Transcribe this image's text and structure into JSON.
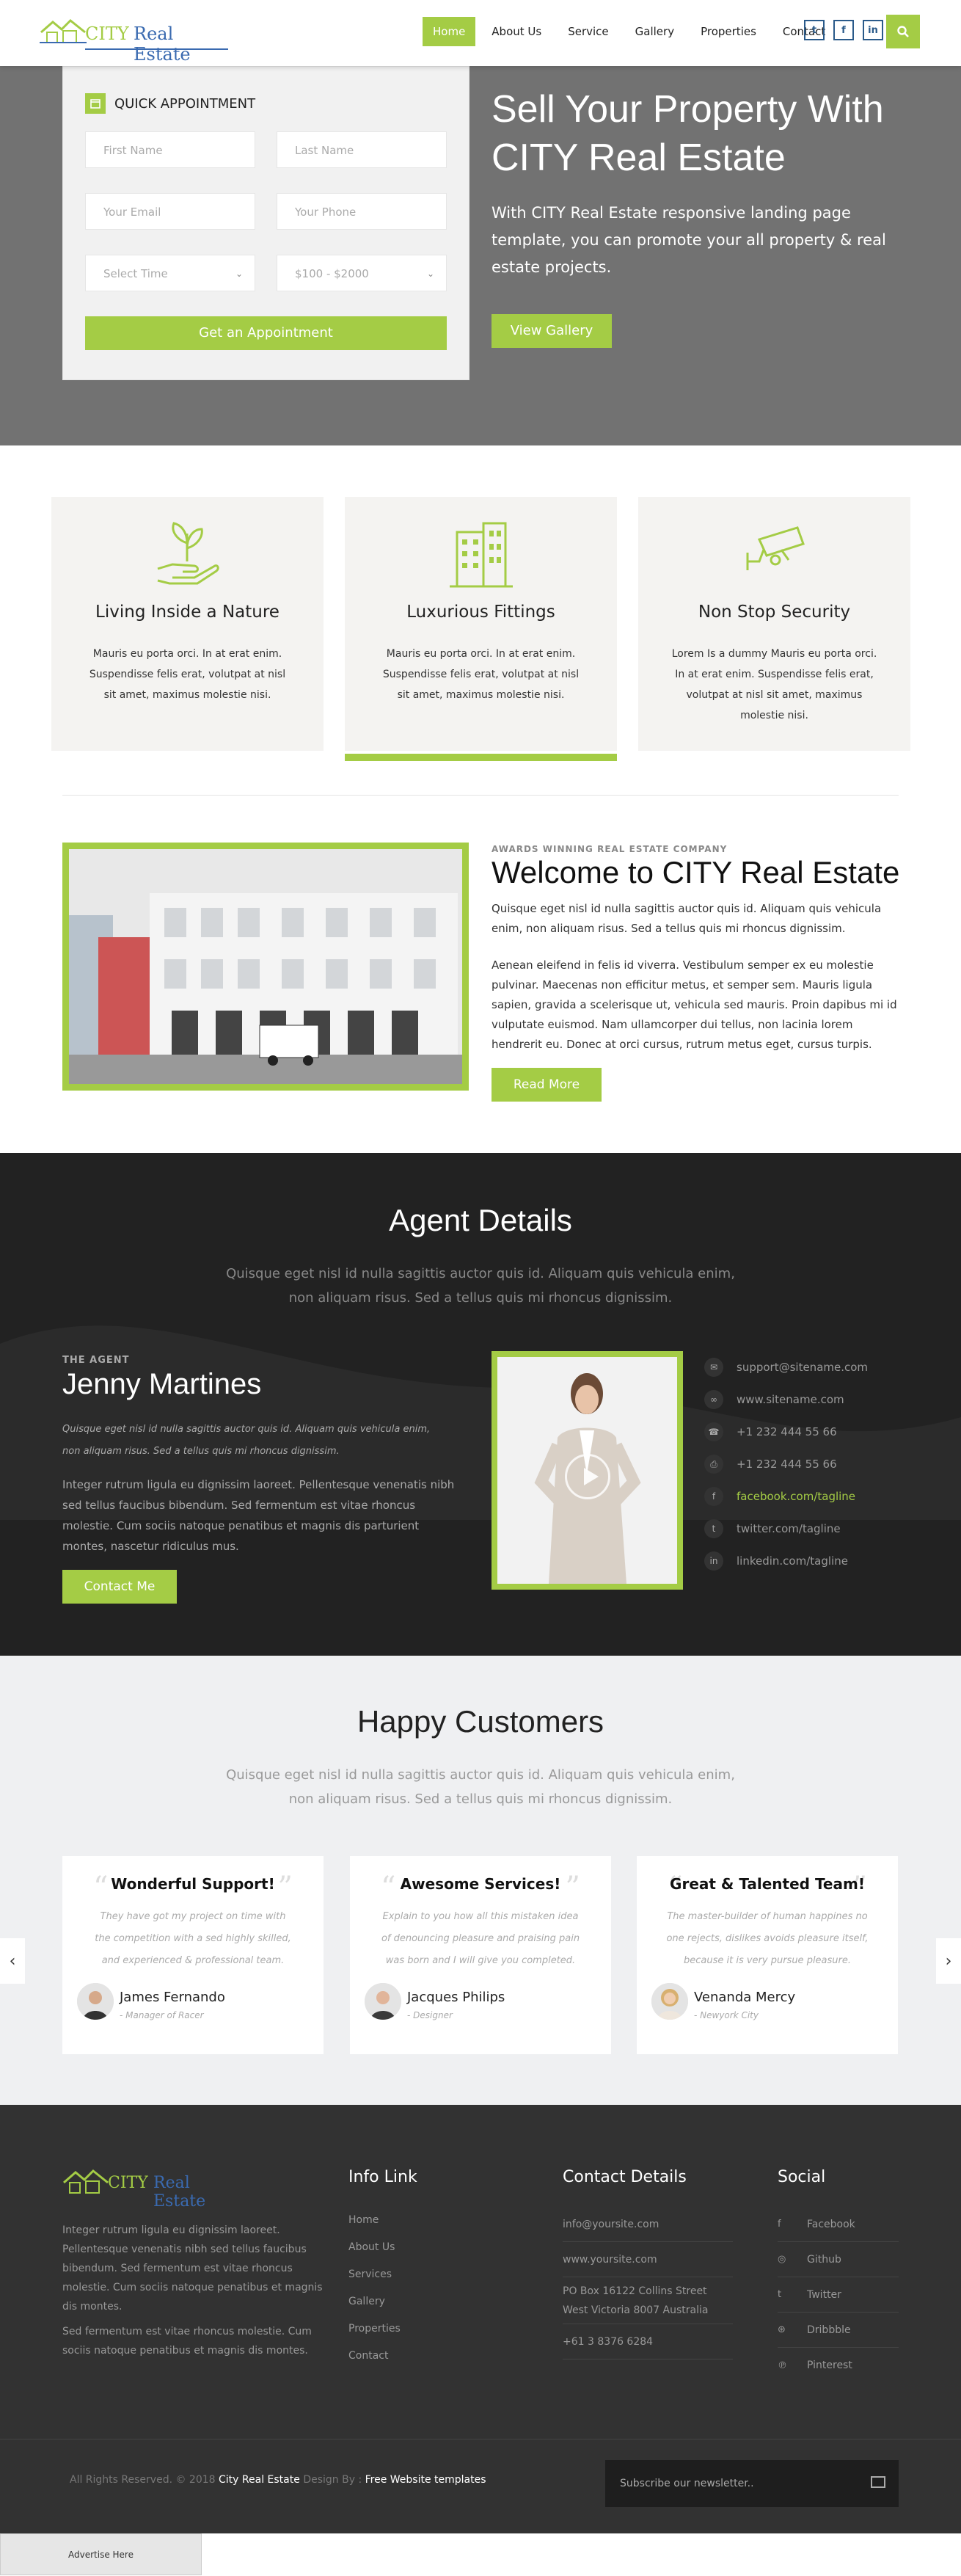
{
  "header": {
    "logo_part1": "CITY",
    "logo_part2": "Real Estate",
    "nav": [
      "Home",
      "About Us",
      "Service",
      "Gallery",
      "Properties",
      "Contact"
    ],
    "social": [
      "twitter-icon",
      "facebook-icon",
      "linkedin-icon"
    ],
    "search_icon": "search-icon"
  },
  "hero": {
    "form_title": "QUICK APPOINTMENT",
    "first_name": "First Name",
    "last_name": "Last Name",
    "email": "Your Email",
    "phone": "Your Phone",
    "time": "Select Time",
    "price": "$100 - $2000",
    "submit": "Get an Appointment",
    "title": "Sell Your Property With CITY Real Estate",
    "text": "With CITY Real Estate responsive landing page template, you can promote your all property & real estate projects.",
    "button": "View Gallery"
  },
  "features": [
    {
      "title": "Living Inside a Nature",
      "text": "Mauris eu porta orci. In at erat enim. Suspendisse felis erat, volutpat at nisl sit amet, maximus molestie nisi.",
      "icon": "plant-hand-icon"
    },
    {
      "title": "Luxurious Fittings",
      "text": "Mauris eu porta orci. In at erat enim. Suspendisse felis erat, volutpat at nisl sit amet, maximus molestie nisi.",
      "icon": "building-icon"
    },
    {
      "title": "Non Stop Security",
      "text": "Lorem Is a dummy Mauris eu porta orci. In at erat enim. Suspendisse felis erat, volutpat at nisl sit amet, maximus molestie nisi.",
      "icon": "cctv-icon"
    }
  ],
  "welcome": {
    "subtitle": "AWARDS WINNING REAL ESTATE COMPANY",
    "title": "Welcome to CITY Real Estate",
    "p1": "Quisque eget nisl id nulla sagittis auctor quis id. Aliquam quis vehicula enim, non aliquam risus. Sed a tellus quis mi rhoncus dignissim.",
    "p2": "Aenean eleifend in felis id viverra. Vestibulum semper ex eu molestie pulvinar. Maecenas non efficitur metus, et semper sem. Mauris ligula sapien, gravida a scelerisque ut, vehicula sed mauris. Proin dapibus mi id vulputate euismod. Nam ullamcorper dui tellus, non lacinia lorem hendrerit eu. Donec at orci cursus, rutrum metus eget, cursus turpis.",
    "button": "Read More"
  },
  "agent": {
    "title": "Agent Details",
    "lead": "Quisque eget nisl id nulla sagittis auctor quis id. Aliquam quis vehicula enim, non aliquam risus. Sed a tellus quis mi rhoncus dignissim.",
    "subtitle": "THE AGENT",
    "name": "Jenny Martines",
    "italic": "Quisque eget nisl id nulla sagittis auctor quis id. Aliquam quis vehicula enim, non aliquam risus. Sed a tellus quis mi rhoncus dignissim.",
    "text": "Integer rutrum ligula eu dignissim laoreet. Pellentesque venenatis nibh sed tellus faucibus bibendum. Sed fermentum est vitae rhoncus molestie. Cum sociis natoque penatibus et magnis dis parturient montes, nascetur ridiculus mus.",
    "button": "Contact Me",
    "contacts": [
      {
        "icon": "envelope-icon",
        "text": "support@sitename.com"
      },
      {
        "icon": "link-icon",
        "text": "www.sitename.com"
      },
      {
        "icon": "phone-icon",
        "text": "+1 232 444 55 66"
      },
      {
        "icon": "print-icon",
        "text": "+1 232 444 55 66"
      },
      {
        "icon": "facebook-icon",
        "text": "facebook.com/tagline"
      },
      {
        "icon": "twitter-icon",
        "text": "twitter.com/tagline"
      },
      {
        "icon": "linkedin-icon",
        "text": "linkedin.com/tagline"
      }
    ]
  },
  "customers": {
    "title": "Happy Customers",
    "lead": "Quisque eget nisl id nulla sagittis auctor quis id. Aliquam quis vehicula enim, non aliquam risus. Sed a tellus quis mi rhoncus dignissim.",
    "cards": [
      {
        "title": "Wonderful Support!",
        "text": "They have got my project on time with the competition with a sed highly skilled, and experienced & professional team.",
        "name": "James Fernando",
        "role": "- Manager of Racer"
      },
      {
        "title": "Awesome Services!",
        "text": "Explain to you how all this mistaken idea of denouncing pleasure and praising pain was born and I will give you completed.",
        "name": "Jacques Philips",
        "role": "- Designer"
      },
      {
        "title": "Great & Talented Team!",
        "text": "The master-builder of human happines no one rejects, dislikes avoids pleasure itself, because it is very pursue pleasure.",
        "name": "Venanda Mercy",
        "role": "- Newyork City"
      }
    ]
  },
  "footer": {
    "about1": "Integer rutrum ligula eu dignissim laoreet. Pellentesque venenatis nibh sed tellus faucibus bibendum. Sed fermentum est vitae rhoncus molestie. Cum sociis natoque penatibus et magnis dis montes.",
    "about2": "Sed fermentum est vitae rhoncus molestie. Cum sociis natoque penatibus et magnis dis montes.",
    "info_title": "Info Link",
    "info_links": [
      "Home",
      "About Us",
      "Services",
      "Gallery",
      "Properties",
      "Contact"
    ],
    "contact_title": "Contact Details",
    "contact": [
      "info@yoursite.com",
      "www.yoursite.com",
      "PO Box 16122 Collins Street West Victoria 8007 Australia",
      "+61 3 8376 6284"
    ],
    "social_title": "Social",
    "social": [
      {
        "icon": "facebook-icon",
        "label": "Facebook"
      },
      {
        "icon": "github-icon",
        "label": "Github"
      },
      {
        "icon": "twitter-icon",
        "label": "Twitter"
      },
      {
        "icon": "dribbble-icon",
        "label": "Dribbble"
      },
      {
        "icon": "pinterest-icon",
        "label": "Pinterest"
      }
    ],
    "copy_prefix": "All Rights Reserved. © 2018",
    "copy_brand": "City Real Estate",
    "copy_mid": "Design By :",
    "copy_link": "Free Website templates",
    "subscribe": "Subscribe our newsletter..",
    "advertise": "Advertise Here"
  },
  "colors": {
    "accent": "#a4cc45",
    "dark": "#222222",
    "footer": "#323232"
  }
}
